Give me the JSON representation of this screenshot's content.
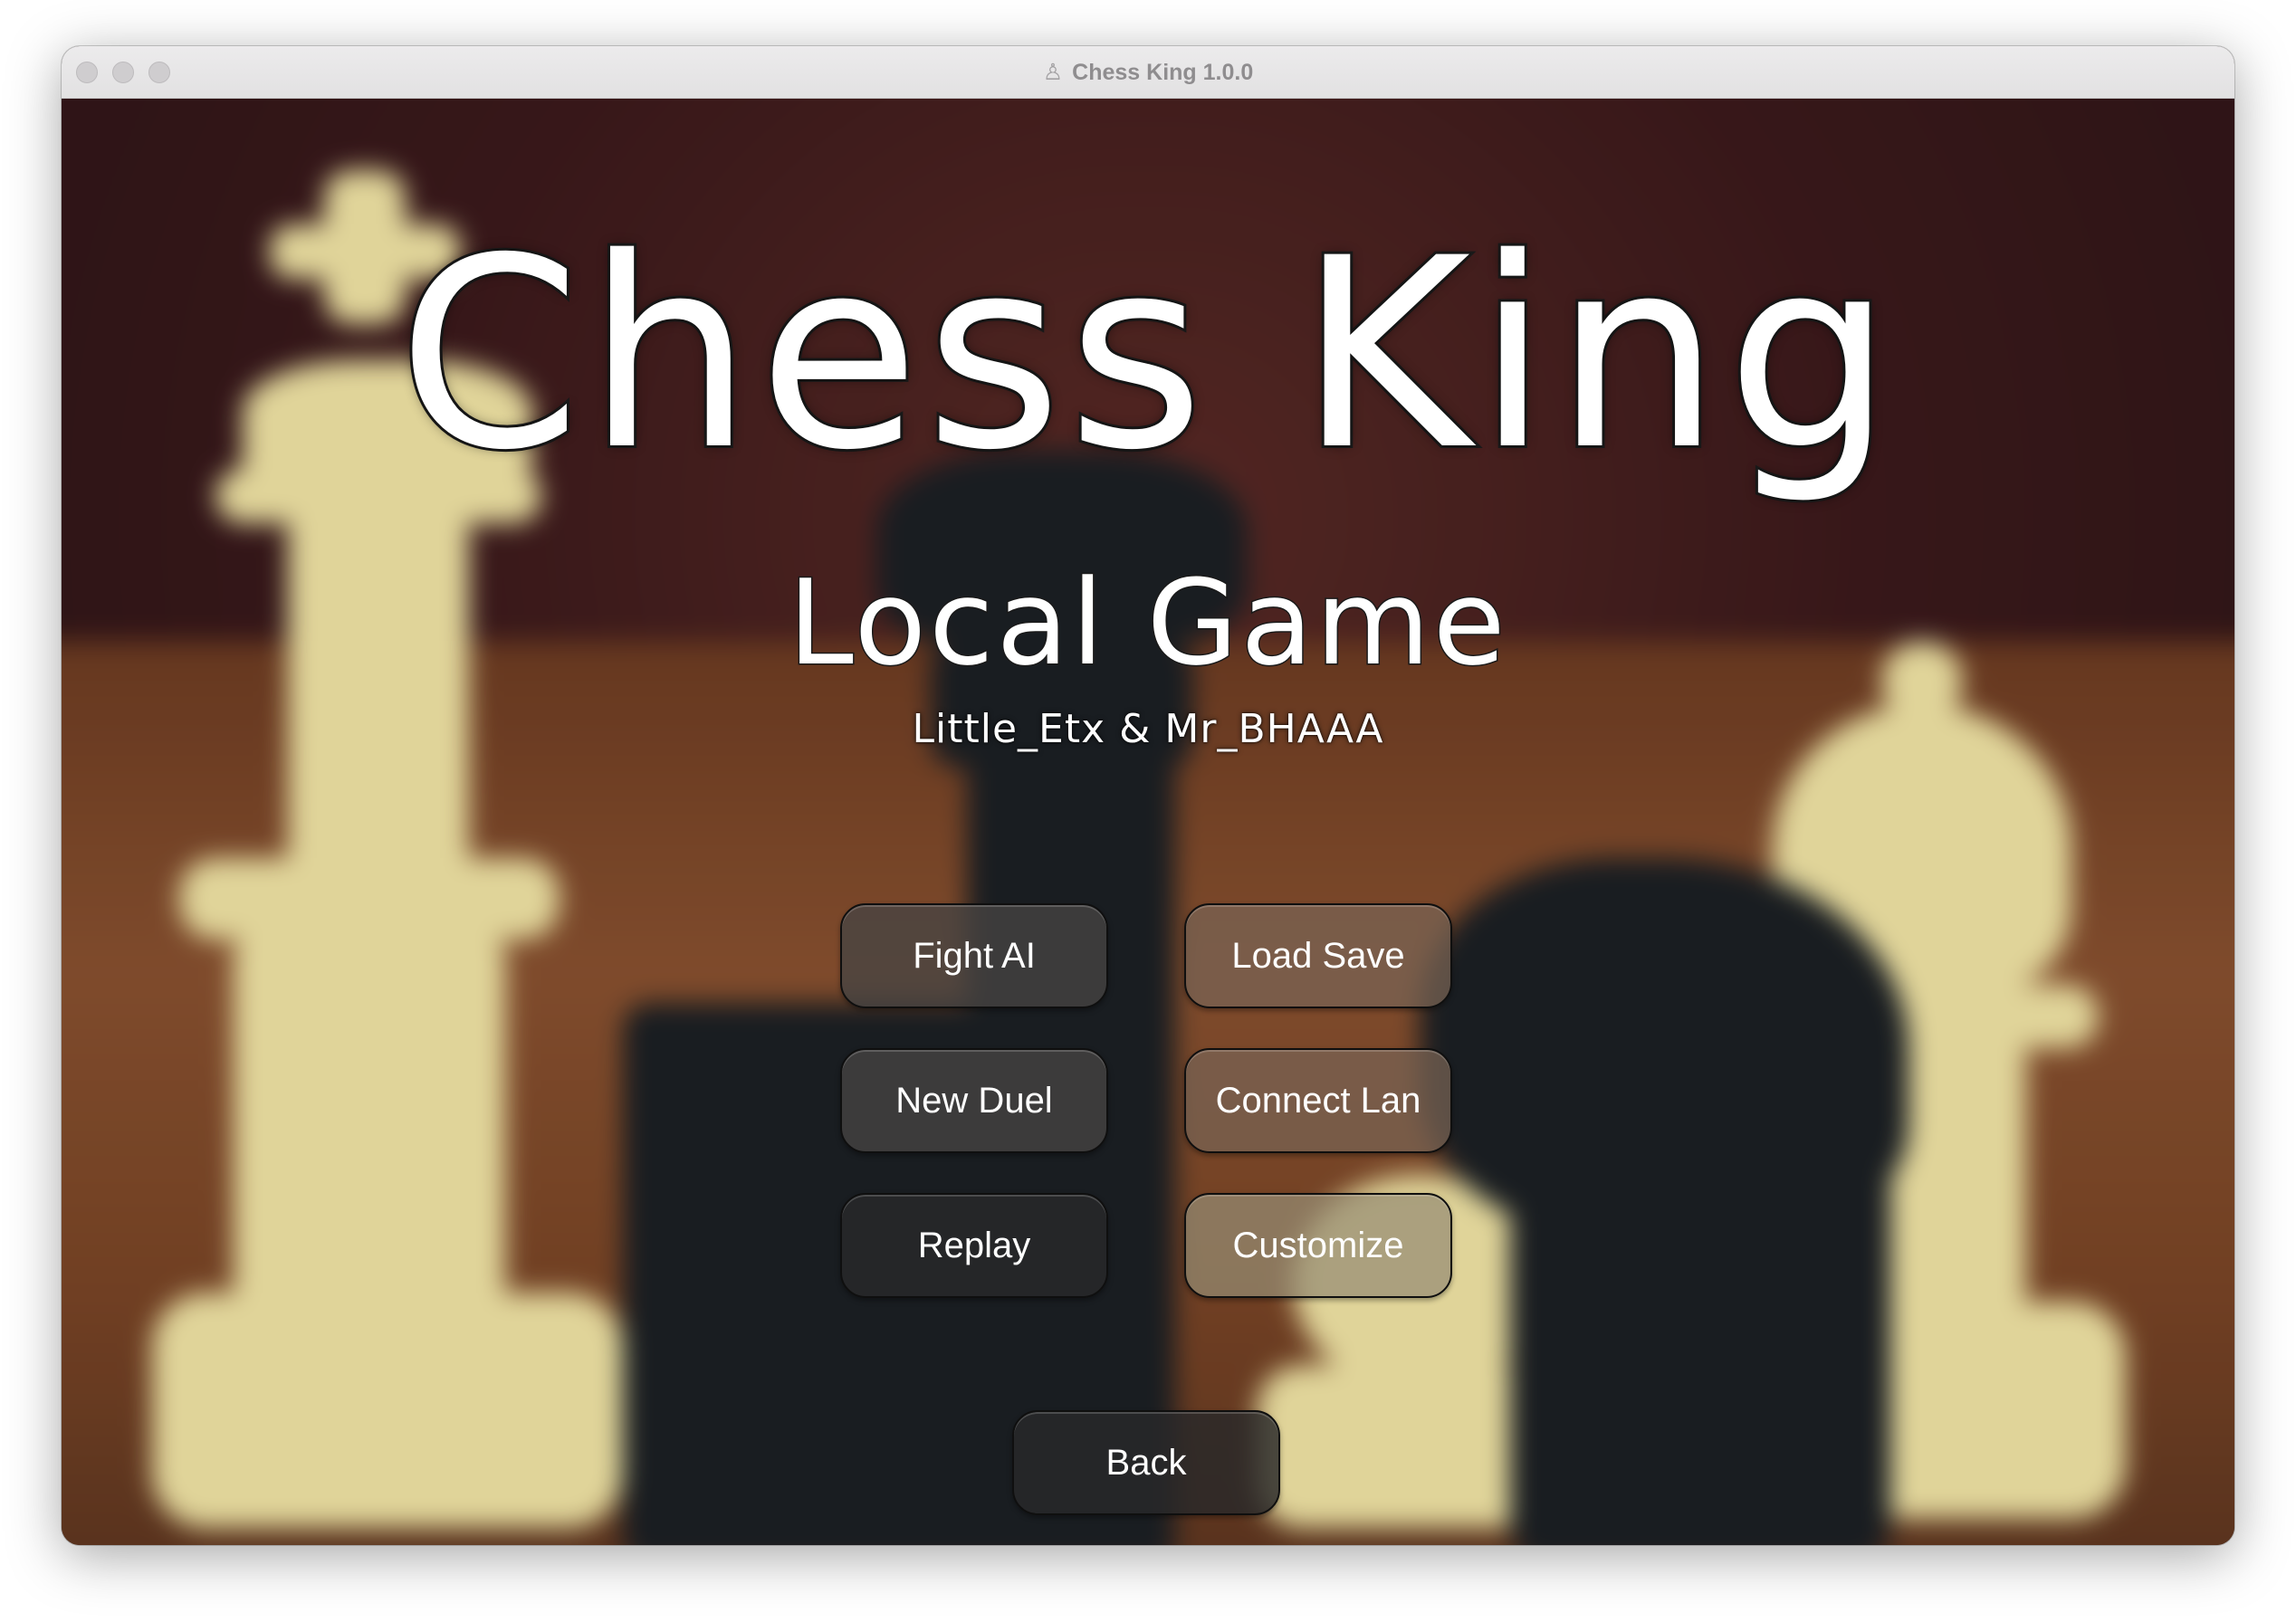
{
  "window": {
    "title": "Chess King 1.0.0",
    "title_icon": "chess-pawn-icon"
  },
  "main": {
    "title": "Chess King",
    "subtitle": "Local Game",
    "players": "Little_Etx & Mr_BHAAA"
  },
  "menu": {
    "fight_ai": "Fight AI",
    "load_save": "Load Save",
    "new_duel": "New Duel",
    "connect_lan": "Connect Lan",
    "replay": "Replay",
    "customize": "Customize",
    "back": "Back"
  },
  "colors": {
    "title_text": "#ffffff",
    "button_bg": "#464442",
    "button_border": "#0f0f0f"
  }
}
